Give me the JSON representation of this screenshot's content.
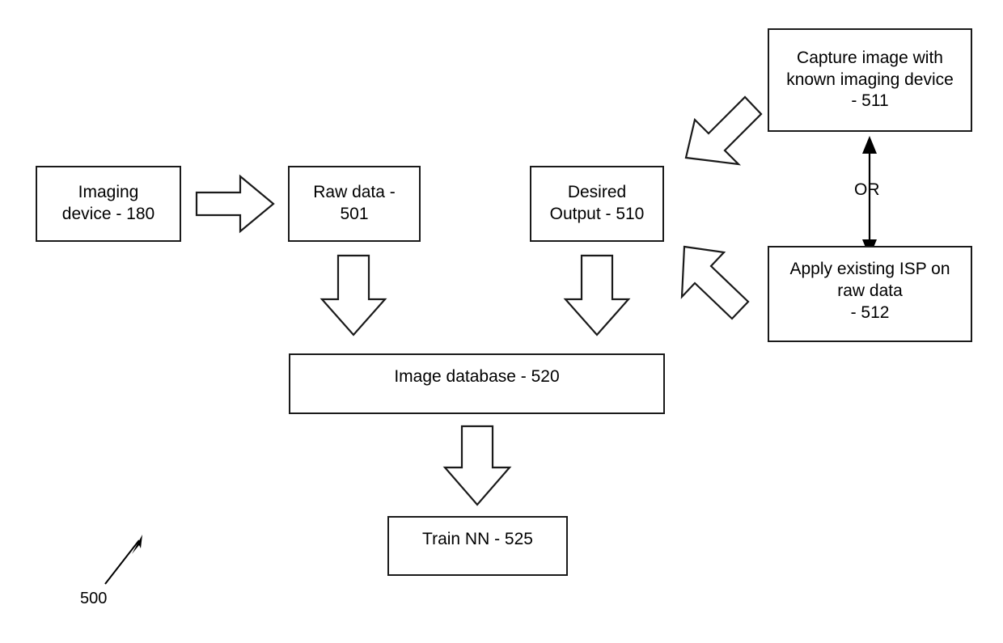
{
  "figure": {
    "reference_numeral": "500",
    "leader_arrow_icon": "diagonal-leader-arrow-icon"
  },
  "nodes": {
    "imaging_device": {
      "label": "Imaging\ndevice - 180"
    },
    "raw_data": {
      "label": "Raw data -\n501"
    },
    "desired_output": {
      "label": "Desired\nOutput - 510"
    },
    "capture_image": {
      "label": "Capture image with\nknown imaging device\n- 511"
    },
    "apply_isp": {
      "label": "Apply existing ISP on\nraw data\n- 512"
    },
    "image_database": {
      "label": "Image database - 520"
    },
    "train_nn": {
      "label": "Train NN - 525"
    }
  },
  "connectors": {
    "or_label": "OR",
    "imaging_to_raw_icon": "block-arrow-right-icon",
    "raw_to_database_icon": "block-arrow-down-icon",
    "desired_to_database_icon": "block-arrow-down-icon",
    "database_to_train_icon": "block-arrow-down-icon",
    "capture_to_desired_icon": "block-arrow-down-left-icon",
    "apply_to_desired_icon": "block-arrow-up-left-icon",
    "capture_apply_or_icon": "double-headed-vertical-arrow-icon"
  },
  "colors": {
    "stroke": "#1a1a1a",
    "fill": "#ffffff",
    "text": "#000000"
  }
}
